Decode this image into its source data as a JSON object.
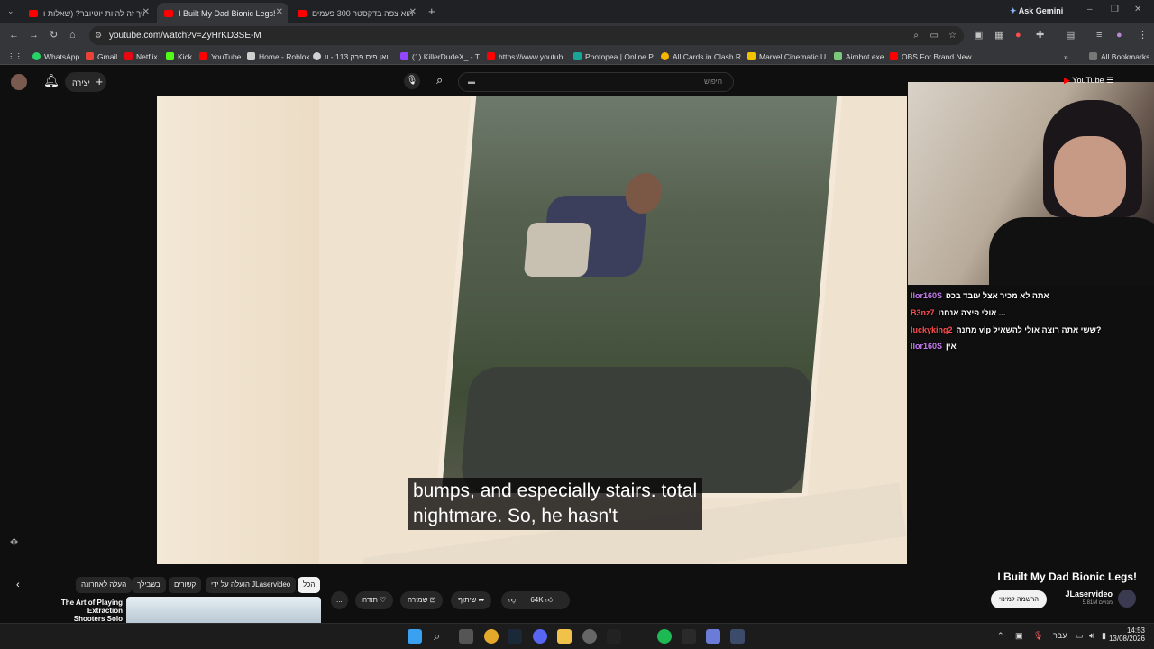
{
  "browser": {
    "tabs": [
      {
        "title": "איך זה להיות יוטיובר? (שאלות ו"
      },
      {
        "title": "I Built My Dad Bionic Legs! - Yo"
      },
      {
        "title": "הוא צפה בדקסטר 300 פעמים"
      }
    ],
    "new_tab": "+",
    "ask_gemini": "Ask Gemini",
    "url": "youtube.com/watch?v=ZyHrKD3SE-M",
    "bookmarks": [
      "WhatsApp",
      "Gmail",
      "Netflix",
      "Kick",
      "YouTube",
      "Home - Roblox",
      "וואן פיס פרק 113 - וו...",
      "(1) KillerDudeX_ - T...",
      "https://www.youtub...",
      "Photopea | Online P...",
      "All Cards in Clash R...",
      "Marvel Cinematic U...",
      "Aimbot.exe",
      "OBS For Brand New..."
    ],
    "all_bookmarks": "All Bookmarks"
  },
  "youtube": {
    "create_label": "יצירה",
    "search_placeholder": "חיפוש",
    "logo": "YouTube"
  },
  "video": {
    "caption_line1": "bumps, and especially stairs. total",
    "caption_line2": "nightmare. So, he hasn't",
    "title": "I Built My Dad Bionic Legs!",
    "channel": "JLaservideo",
    "subscribers": "5.81M מנויים",
    "subscribe_label": "הרשמה למינוי",
    "likes": "64K",
    "share": "שיתוף",
    "save": "שמירה",
    "thanks": "תודה",
    "more": "..."
  },
  "chat": [
    {
      "user": "llor160S",
      "text": "אתה לא מכיר אצל עובד בכפ",
      "color": "#c87bf2"
    },
    {
      "user": "B3nz7",
      "text": "אולי פיצה אנחנו ...",
      "color": "#ff4d4d"
    },
    {
      "user": "luckyking2",
      "text": "מתנה vip ששי אתה רוצה אולי להשאיל?",
      "color": "#ff4d4d"
    },
    {
      "user": "llor160S",
      "text": "אין",
      "color": "#c87bf2"
    }
  ],
  "chips": [
    "הכל",
    "הועלה על ידי JLaservideo",
    "קשורים",
    "בשבילך",
    "העלה לאחרונה"
  ],
  "recommendation": {
    "title": "The Art of Playing Extraction",
    "title2": "Shooters Solo"
  },
  "taskbar": {
    "lang": "עבר",
    "time": "14:53",
    "date": "13/08/2026"
  },
  "colors": {
    "accent": "#ff0000",
    "bg": "#0f0f0f"
  }
}
